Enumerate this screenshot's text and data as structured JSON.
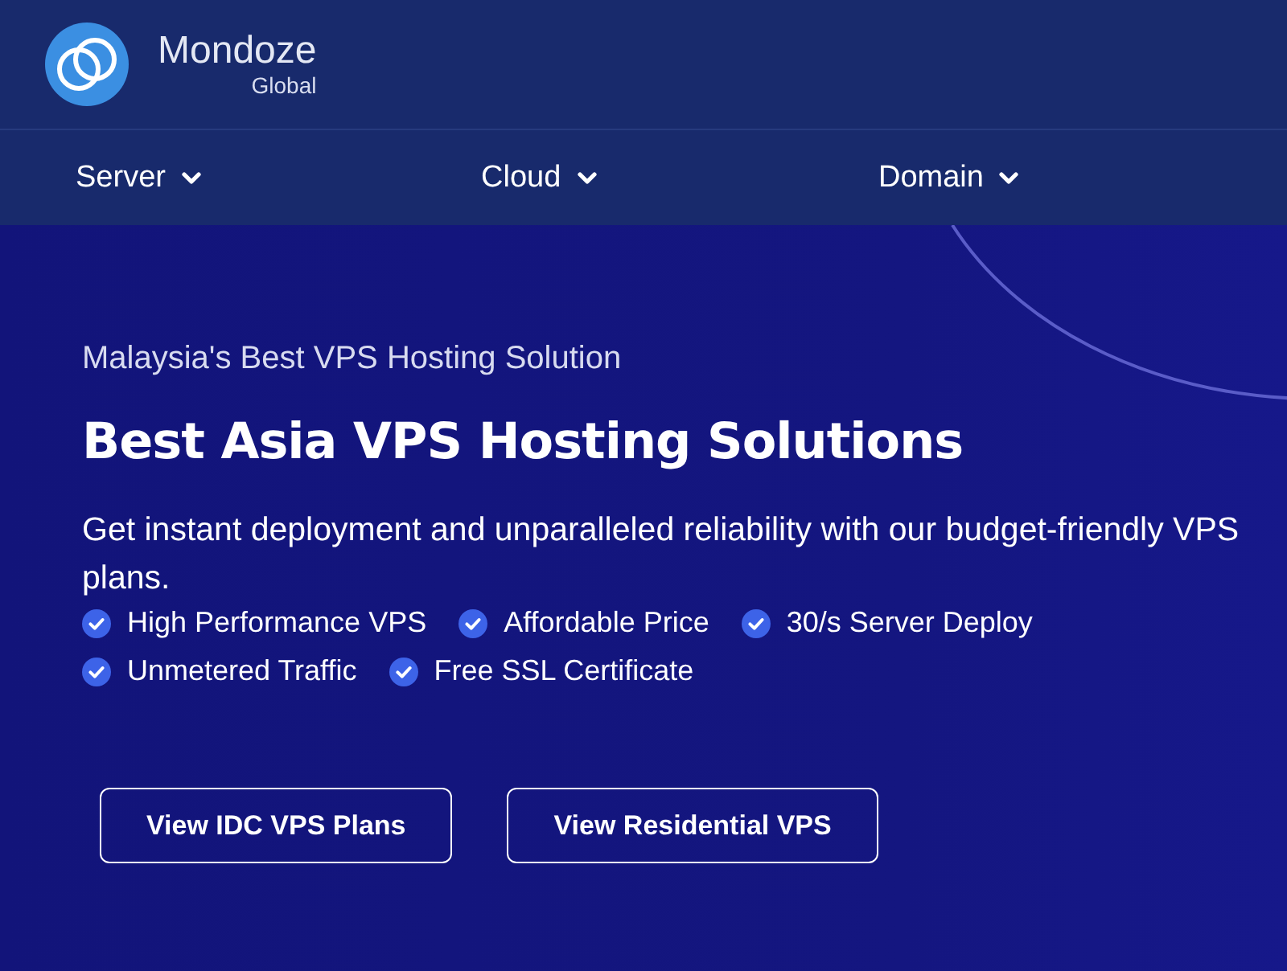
{
  "brand": {
    "name": "Mondoze",
    "tagline": "Global"
  },
  "nav": [
    {
      "label": "Server"
    },
    {
      "label": "Cloud"
    },
    {
      "label": "Domain"
    }
  ],
  "hero": {
    "eyebrow": "Malaysia's Best VPS Hosting Solution",
    "title": "Best Asia VPS Hosting Solutions",
    "description": "Get instant deployment and unparalleled reliability with our budget-friendly VPS plans.",
    "features": [
      "High Performance VPS",
      "Affordable Price",
      "30/s Server Deploy",
      "Unmetered Traffic",
      "Free SSL Certificate"
    ],
    "buttons": [
      "View IDC VPS Plans",
      "View Residential VPS"
    ]
  }
}
